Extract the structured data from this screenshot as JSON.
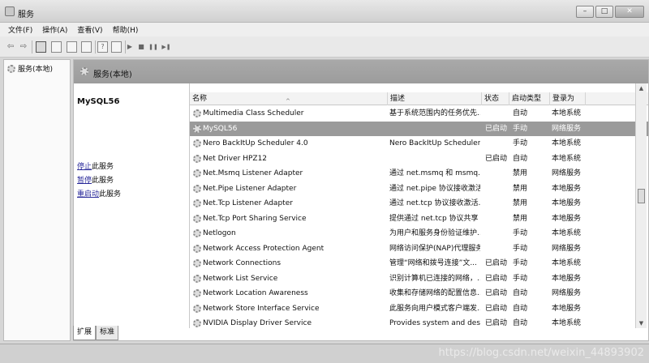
{
  "window": {
    "title": "服务",
    "buttons": {
      "minimize": "–",
      "maximize": "□",
      "close": "✕"
    }
  },
  "menu": [
    "文件(F)",
    "操作(A)",
    "查看(V)",
    "帮助(H)"
  ],
  "toolbar": {
    "back": "⇦",
    "forward": "⇨",
    "play": "▶",
    "stop": "■",
    "pause": "❚❚",
    "restart": "▶❚",
    "help": "?"
  },
  "tree": {
    "label": "服务(本地)"
  },
  "pane": {
    "title": "服务(本地)",
    "selected_service": "MySQL56",
    "actions": [
      {
        "link": "停止",
        "text": "此服务"
      },
      {
        "link": "暂停",
        "text": "此服务"
      },
      {
        "link": "重启动",
        "text": "此服务"
      }
    ]
  },
  "table": {
    "headers": {
      "name": "名称",
      "desc": "描述",
      "status": "状态",
      "startup": "启动类型",
      "logon": "登录为"
    },
    "sort_indicator": "^",
    "rows": [
      {
        "name": "Multimedia Class Scheduler",
        "desc": "基于系统范围内的任务优先...",
        "status": "",
        "startup": "自动",
        "logon": "本地系统"
      },
      {
        "name": "MySQL56",
        "desc": "",
        "status": "已启动",
        "startup": "手动",
        "logon": "网络服务"
      },
      {
        "name": "Nero BackItUp Scheduler 4.0",
        "desc": "Nero BackItUp Scheduler ...",
        "status": "",
        "startup": "手动",
        "logon": "本地系统"
      },
      {
        "name": "Net Driver HPZ12",
        "desc": "",
        "status": "已启动",
        "startup": "自动",
        "logon": "本地系统"
      },
      {
        "name": "Net.Msmq Listener Adapter",
        "desc": "通过 net.msmq 和 msmq.f...",
        "status": "",
        "startup": "禁用",
        "logon": "网络服务"
      },
      {
        "name": "Net.Pipe Listener Adapter",
        "desc": "通过 net.pipe 协议接收激活...",
        "status": "",
        "startup": "禁用",
        "logon": "本地服务"
      },
      {
        "name": "Net.Tcp Listener Adapter",
        "desc": "通过 net.tcp 协议接收激活...",
        "status": "",
        "startup": "禁用",
        "logon": "本地服务"
      },
      {
        "name": "Net.Tcp Port Sharing Service",
        "desc": "提供通过 net.tcp 协议共享 T...",
        "status": "",
        "startup": "禁用",
        "logon": "本地服务"
      },
      {
        "name": "Netlogon",
        "desc": "为用户和服务身份验证维护...",
        "status": "",
        "startup": "手动",
        "logon": "本地系统"
      },
      {
        "name": "Network Access Protection Agent",
        "desc": "网络访问保护(NAP)代理服务...",
        "status": "",
        "startup": "手动",
        "logon": "网络服务"
      },
      {
        "name": "Network Connections",
        "desc": "管理“网络和拨号连接”文...",
        "status": "已启动",
        "startup": "手动",
        "logon": "本地系统"
      },
      {
        "name": "Network List Service",
        "desc": "识别计算机已连接的网络，...",
        "status": "已启动",
        "startup": "手动",
        "logon": "本地服务"
      },
      {
        "name": "Network Location Awareness",
        "desc": "收集和存储网络的配置信息...",
        "status": "已启动",
        "startup": "自动",
        "logon": "网络服务"
      },
      {
        "name": "Network Store Interface Service",
        "desc": "此服务向用户模式客户端发...",
        "status": "已启动",
        "startup": "自动",
        "logon": "本地服务"
      },
      {
        "name": "NVIDIA Display Driver Service",
        "desc": "Provides system and deskt...",
        "status": "已启动",
        "startup": "自动",
        "logon": "本地系统"
      }
    ]
  },
  "tabs": [
    "扩展",
    "标准"
  ],
  "watermark": "https://blog.csdn.net/weixin_44893902"
}
